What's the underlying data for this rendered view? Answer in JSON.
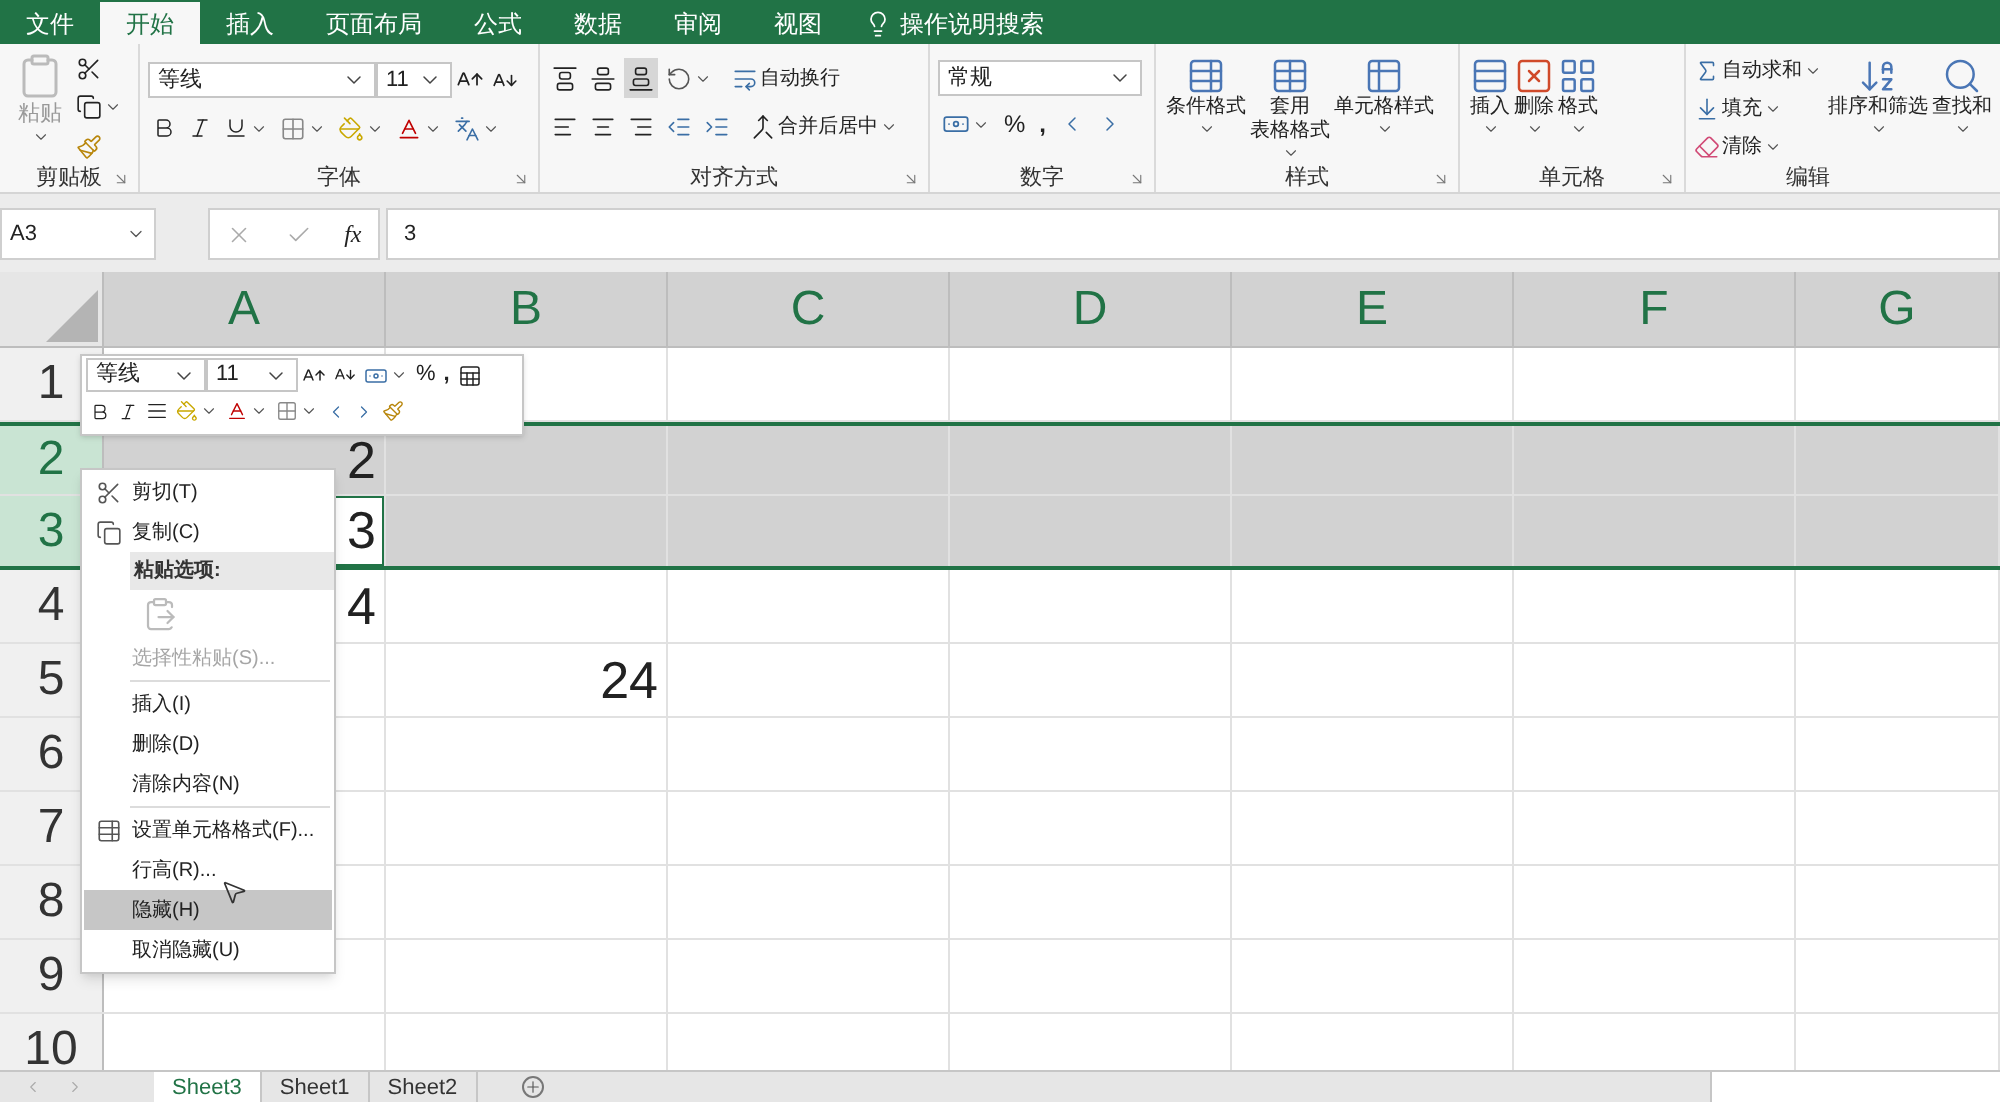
{
  "menu_tabs": [
    {
      "label": "文件",
      "selected": false
    },
    {
      "label": "开始",
      "selected": true
    },
    {
      "label": "插入",
      "selected": false
    },
    {
      "label": "页面布局",
      "selected": false
    },
    {
      "label": "公式",
      "selected": false
    },
    {
      "label": "数据",
      "selected": false
    },
    {
      "label": "审阅",
      "selected": false
    },
    {
      "label": "视图",
      "selected": false
    }
  ],
  "tell_me": "操作说明搜索",
  "ribbon": {
    "clipboard": {
      "title": "剪贴板",
      "paste": "粘贴"
    },
    "font": {
      "title": "字体",
      "font_name": "等线",
      "font_size": "11"
    },
    "alignment": {
      "title": "对齐方式",
      "wrap": "自动换行",
      "merge": "合并后居中"
    },
    "number": {
      "title": "数字",
      "format": "常规",
      "percent": "%",
      "comma": ","
    },
    "styles": {
      "title": "样式",
      "buttons": [
        [
          "条件格式"
        ],
        [
          "套用",
          "表格格式"
        ],
        [
          "单元格样式"
        ]
      ]
    },
    "cells": {
      "title": "单元格",
      "buttons": [
        "插入",
        "删除",
        "格式"
      ]
    },
    "editing": {
      "title": "编辑",
      "small": [
        "自动求和",
        "填充",
        "清除"
      ],
      "large": [
        "排序和筛选",
        "查找和"
      ]
    }
  },
  "formula_bar": {
    "name_box": "A3",
    "function_label": "fx",
    "value": "3"
  },
  "columns": [
    {
      "label": "A",
      "selected": true
    },
    {
      "label": "B",
      "selected": true
    },
    {
      "label": "C",
      "selected": true
    },
    {
      "label": "D",
      "selected": true
    },
    {
      "label": "E",
      "selected": true
    },
    {
      "label": "F",
      "selected": true
    },
    {
      "label": "G",
      "selected": true
    }
  ],
  "rows": [
    {
      "label": "1",
      "selected": false
    },
    {
      "label": "2",
      "selected": true,
      "cells": [
        {
          "text": "2",
          "active": false
        }
      ]
    },
    {
      "label": "3",
      "selected": true,
      "cells": [
        {
          "text": "3",
          "active": true
        }
      ]
    },
    {
      "label": "4",
      "selected": false,
      "cells": [
        {
          "text": "4",
          "active": false
        }
      ]
    },
    {
      "label": "5",
      "selected": false,
      "cells": [
        null,
        {
          "text": "24",
          "active": false
        }
      ]
    },
    {
      "label": "6",
      "selected": false
    },
    {
      "label": "7",
      "selected": false
    },
    {
      "label": "8",
      "selected": false
    },
    {
      "label": "9",
      "selected": false
    },
    {
      "label": "10",
      "selected": false
    }
  ],
  "mini_toolbar": {
    "font_name": "等线",
    "font_size": "11",
    "percent": "%",
    "comma": ","
  },
  "context_menu": [
    {
      "kind": "command",
      "label": "剪切(T)",
      "disabled": false,
      "selected": false
    },
    {
      "kind": "command",
      "label": "复制(C)",
      "disabled": false,
      "selected": false
    },
    {
      "kind": "header",
      "label": "粘贴选项:"
    },
    {
      "kind": "paste"
    },
    {
      "kind": "command",
      "label": "选择性粘贴(S)...",
      "disabled": true,
      "selected": false
    },
    {
      "kind": "separator"
    },
    {
      "kind": "command",
      "label": "插入(I)",
      "disabled": false,
      "selected": false
    },
    {
      "kind": "command",
      "label": "删除(D)",
      "disabled": false,
      "selected": false
    },
    {
      "kind": "command",
      "label": "清除内容(N)",
      "disabled": false,
      "selected": false
    },
    {
      "kind": "separator"
    },
    {
      "kind": "command",
      "label": "设置单元格格式(F)...",
      "disabled": false,
      "selected": false
    },
    {
      "kind": "command",
      "label": "行高(R)...",
      "disabled": false,
      "selected": false
    },
    {
      "kind": "command",
      "label": "隐藏(H)",
      "disabled": false,
      "selected": true
    },
    {
      "kind": "command",
      "label": "取消隐藏(U)",
      "disabled": false,
      "selected": false
    }
  ],
  "sheet_tabs": [
    {
      "label": "Sheet3",
      "selected": true
    },
    {
      "label": "Sheet1",
      "selected": false
    },
    {
      "label": "Sheet2",
      "selected": false
    }
  ]
}
